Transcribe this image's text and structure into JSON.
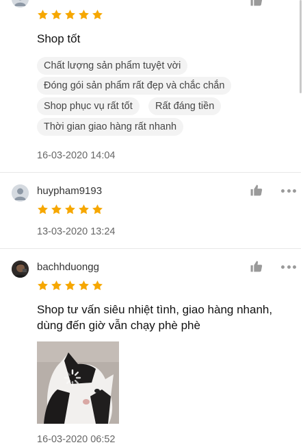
{
  "reviews": [
    {
      "text": "Shop tốt",
      "tags": [
        "Chất lượng sản phẩm tuyệt vời",
        "Đóng gói sản phẩm rất đẹp và chắc chắn",
        "Shop phục vụ rất tốt",
        "Rất đáng tiền",
        "Thời gian giao hàng rất nhanh"
      ],
      "date": "16-03-2020 14:04",
      "rating": 5
    },
    {
      "username": "huypham9193",
      "date": "13-03-2020 13:24",
      "rating": 5
    },
    {
      "username": "bachhduongg",
      "text": "Shop tư vấn siêu nhiệt tình, giao hàng nhanh, dùng đến giờ vẫn chạy phè phè",
      "date": "16-03-2020 06:52",
      "rating": 5
    }
  ],
  "colors": {
    "star": "#f6a700",
    "tag_bg": "#f3f3f3",
    "icon": "#9a9a9a"
  },
  "icons": {
    "like": "thumbs-up-icon",
    "more": "more-options-icon",
    "star": "star-icon"
  }
}
